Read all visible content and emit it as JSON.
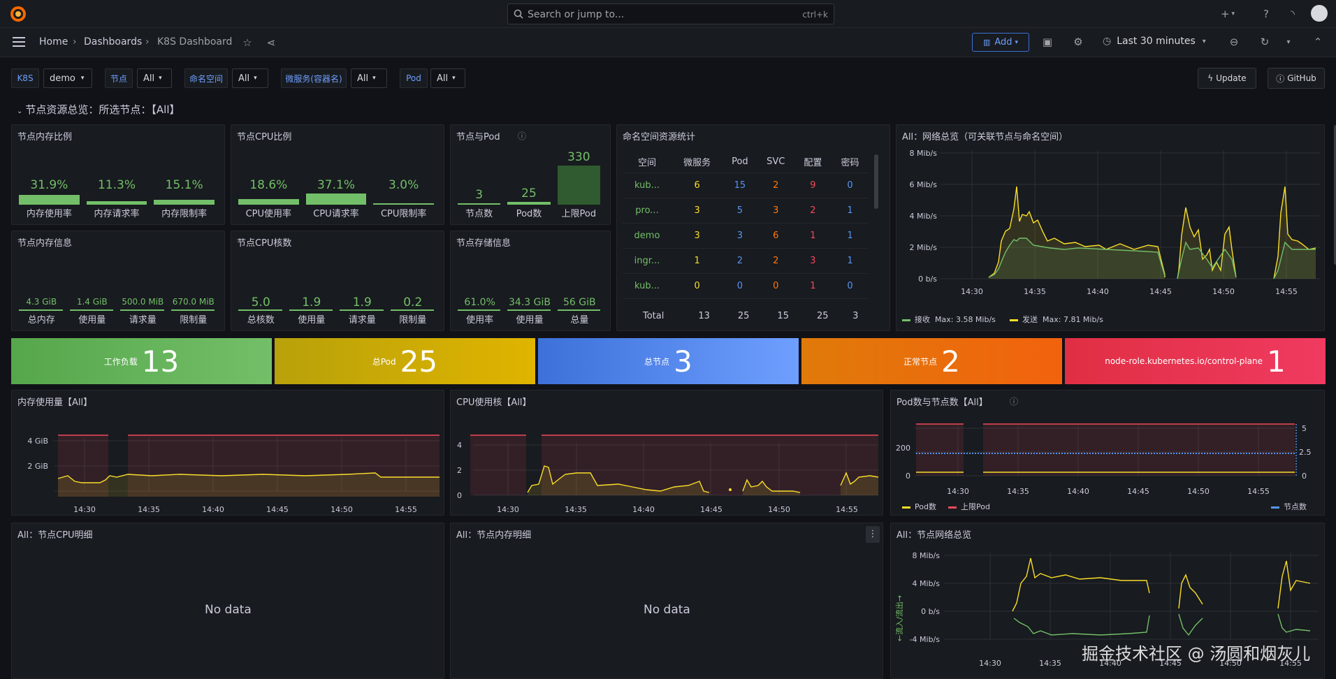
{
  "top": {
    "search_placeholder": "Search or jump to...",
    "search_shortcut": "ctrl+k",
    "plus": "+"
  },
  "nav": {
    "breadcrumb": [
      "Home",
      "Dashboards",
      "K8S Dashboard"
    ],
    "add": "Add",
    "time_range": "Last 30 minutes"
  },
  "vars": [
    {
      "label": "K8S",
      "value": "demo"
    },
    {
      "label": "节点",
      "value": "All"
    },
    {
      "label": "命名空间",
      "value": "All"
    },
    {
      "label": "微服务(容器名)",
      "value": "All"
    },
    {
      "label": "Pod",
      "value": "All"
    }
  ],
  "actions": {
    "update": "Update",
    "github": "GitHub"
  },
  "row_title": "节点资源总览：所选节点：【All】",
  "mem_ratio": {
    "title": "节点内存比例",
    "items": [
      {
        "value": "31.9%",
        "label": "内存使用率",
        "fill": 0.319
      },
      {
        "value": "11.3%",
        "label": "内存请求率",
        "fill": 0.113
      },
      {
        "value": "15.1%",
        "label": "内存限制率",
        "fill": 0.151
      }
    ]
  },
  "cpu_ratio": {
    "title": "节点CPU比例",
    "items": [
      {
        "value": "18.6%",
        "label": "CPU使用率",
        "fill": 0.186
      },
      {
        "value": "37.1%",
        "label": "CPU请求率",
        "fill": 0.371
      },
      {
        "value": "3.0%",
        "label": "CPU限制率",
        "fill": 0.03
      }
    ]
  },
  "node_pod": {
    "title": "节点与Pod",
    "items": [
      {
        "value": "3",
        "label": "节点数",
        "fill": 0.01
      },
      {
        "value": "25",
        "label": "Pod数",
        "fill": 0.076
      },
      {
        "value": "330",
        "label": "上限Pod",
        "fill": 1
      }
    ]
  },
  "mem_info": {
    "title": "节点内存信息",
    "items": [
      {
        "value": "4.3 GiB",
        "label": "总内存"
      },
      {
        "value": "1.4 GiB",
        "label": "使用量"
      },
      {
        "value": "500.0 MiB",
        "label": "请求量"
      },
      {
        "value": "670.0 MiB",
        "label": "限制量"
      }
    ]
  },
  "cpu_cores": {
    "title": "节点CPU核数",
    "items": [
      {
        "value": "5.0",
        "label": "总核数"
      },
      {
        "value": "1.9",
        "label": "使用量"
      },
      {
        "value": "1.9",
        "label": "请求量"
      },
      {
        "value": "0.2",
        "label": "限制量"
      }
    ]
  },
  "storage": {
    "title": "节点存储信息",
    "items": [
      {
        "value": "61.0%",
        "label": "使用率"
      },
      {
        "value": "34.3 GiB",
        "label": "使用量"
      },
      {
        "value": "56 GiB",
        "label": "总量"
      }
    ]
  },
  "ns_table": {
    "title": "命名空间资源统计",
    "headers": [
      "空间",
      "微服务",
      "Pod",
      "SVC",
      "配置",
      "密码"
    ],
    "rows": [
      [
        "kub...",
        "6",
        "15",
        "2",
        "9",
        "0"
      ],
      [
        "pro...",
        "3",
        "5",
        "3",
        "2",
        "1"
      ],
      [
        "demo",
        "3",
        "3",
        "6",
        "1",
        "1"
      ],
      [
        "ingr...",
        "1",
        "2",
        "2",
        "3",
        "1"
      ],
      [
        "kub...",
        "0",
        "0",
        "0",
        "1",
        "0"
      ]
    ],
    "total": [
      "Total",
      "13",
      "25",
      "15",
      "25",
      "3"
    ]
  },
  "net_overview": {
    "title": "All：网络总览（可关联节点与命名空间）",
    "yticks": [
      "8 Mib/s",
      "6 Mib/s",
      "4 Mib/s",
      "2 Mib/s",
      "0 b/s"
    ],
    "xticks": [
      "14:30",
      "14:35",
      "14:40",
      "14:45",
      "14:50",
      "14:55"
    ],
    "legend": [
      {
        "name": "接收",
        "stat": "Max: 3.58 Mib/s",
        "color": "#73bf69"
      },
      {
        "name": "发送",
        "stat": "Max: 7.81 Mib/s",
        "color": "#fade2a"
      }
    ]
  },
  "stats": [
    {
      "label": "工作负载",
      "value": "13",
      "color1": "#56a64b",
      "color2": "#73bf69"
    },
    {
      "label": "总Pod",
      "value": "25",
      "color1": "#b8a10a",
      "color2": "#e0b400"
    },
    {
      "label": "总节点",
      "value": "3",
      "color1": "#3d71d9",
      "color2": "#6e9fff"
    },
    {
      "label": "正常节点",
      "value": "2",
      "color1": "#e07a0a",
      "color2": "#f2620d"
    },
    {
      "label": "node-role.kubernetes.io/control-plane",
      "value": "1",
      "color1": "#e02f44",
      "color2": "#f03a60"
    }
  ],
  "mem_usage": {
    "title": "内存使用量【All】",
    "yticks": [
      "4 GiB",
      "2 GiB"
    ],
    "xticks": [
      "14:30",
      "14:35",
      "14:40",
      "14:45",
      "14:50",
      "14:55"
    ]
  },
  "cpu_usage": {
    "title": "CPU使用核【All】",
    "yticks": [
      "4",
      "2",
      "0"
    ],
    "xticks": [
      "14:30",
      "14:35",
      "14:40",
      "14:45",
      "14:50",
      "14:55"
    ]
  },
  "pod_nodes": {
    "title": "Pod数与节点数【All】",
    "yticks_left": [
      "200",
      "0"
    ],
    "yticks_right": [
      "5",
      "2.5",
      "0"
    ],
    "xticks": [
      "14:30",
      "14:35",
      "14:40",
      "14:45",
      "14:50",
      "14:55"
    ],
    "legend": [
      {
        "name": "Pod数",
        "color": "#fade2a"
      },
      {
        "name": "上限Pod",
        "color": "#f2495c"
      }
    ],
    "legend_right": {
      "name": "节点数",
      "color": "#5794f2"
    }
  },
  "cpu_detail": {
    "title": "All：节点CPU明细",
    "nodata": "No data"
  },
  "mem_detail": {
    "title": "All：节点内存明细",
    "nodata": "No data"
  },
  "node_net": {
    "title": "All：节点网络总览",
    "yticks": [
      "8 Mib/s",
      "4 Mib/s",
      "0 b/s",
      "-4 Mib/s"
    ],
    "xticks": [
      "14:30",
      "14:35",
      "14:40",
      "14:45",
      "14:50",
      "14:55"
    ],
    "ylabel": "←流入/流出→"
  },
  "watermark": "掘金技术社区 @ 汤圆和烟灰儿"
}
